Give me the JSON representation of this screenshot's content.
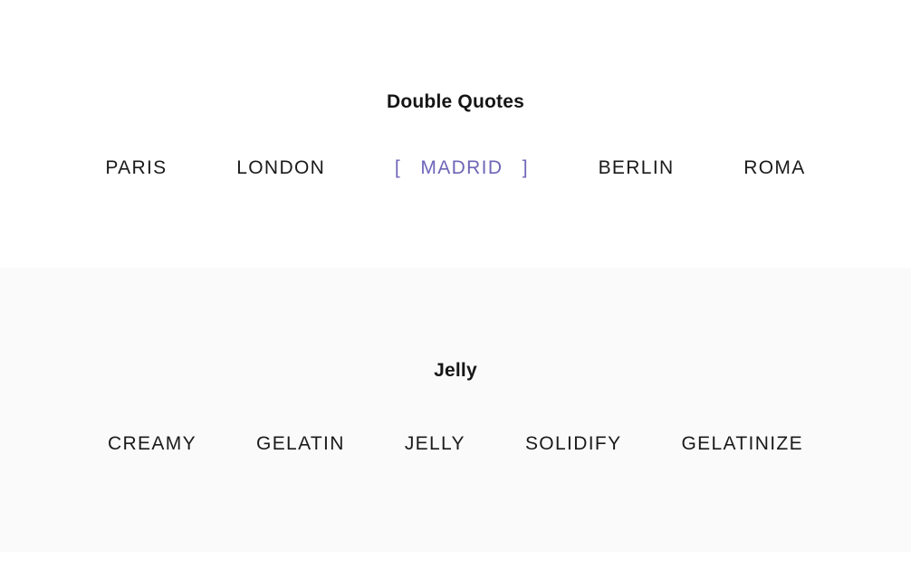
{
  "page": {
    "background_color": "#ffffff",
    "tint_background_color": "#fafafa",
    "text_color": "#1a1a1a",
    "marked_color": "#6e66b8"
  },
  "sections": [
    {
      "title": "Double Quotes",
      "background": "#ffffff",
      "words": [
        {
          "label": "PARIS",
          "marked": false,
          "prefix": "",
          "suffix": ""
        },
        {
          "label": "LONDON",
          "marked": false,
          "prefix": "",
          "suffix": ""
        },
        {
          "label": "MADRID",
          "marked": true,
          "prefix": "[",
          "suffix": "]"
        },
        {
          "label": "BERLIN",
          "marked": false,
          "prefix": "",
          "suffix": ""
        },
        {
          "label": "ROMA",
          "marked": false,
          "prefix": "",
          "suffix": ""
        }
      ]
    },
    {
      "title": "Jelly",
      "background": "#fafafa",
      "words": [
        {
          "label": "CREAMY",
          "marked": false,
          "prefix": "",
          "suffix": ""
        },
        {
          "label": "GELATIN",
          "marked": false,
          "prefix": "",
          "suffix": ""
        },
        {
          "label": "JELLY",
          "marked": false,
          "prefix": "",
          "suffix": ""
        },
        {
          "label": "SOLIDIFY",
          "marked": false,
          "prefix": "",
          "suffix": ""
        },
        {
          "label": "GELATINIZE",
          "marked": false,
          "prefix": "",
          "suffix": ""
        }
      ]
    }
  ]
}
